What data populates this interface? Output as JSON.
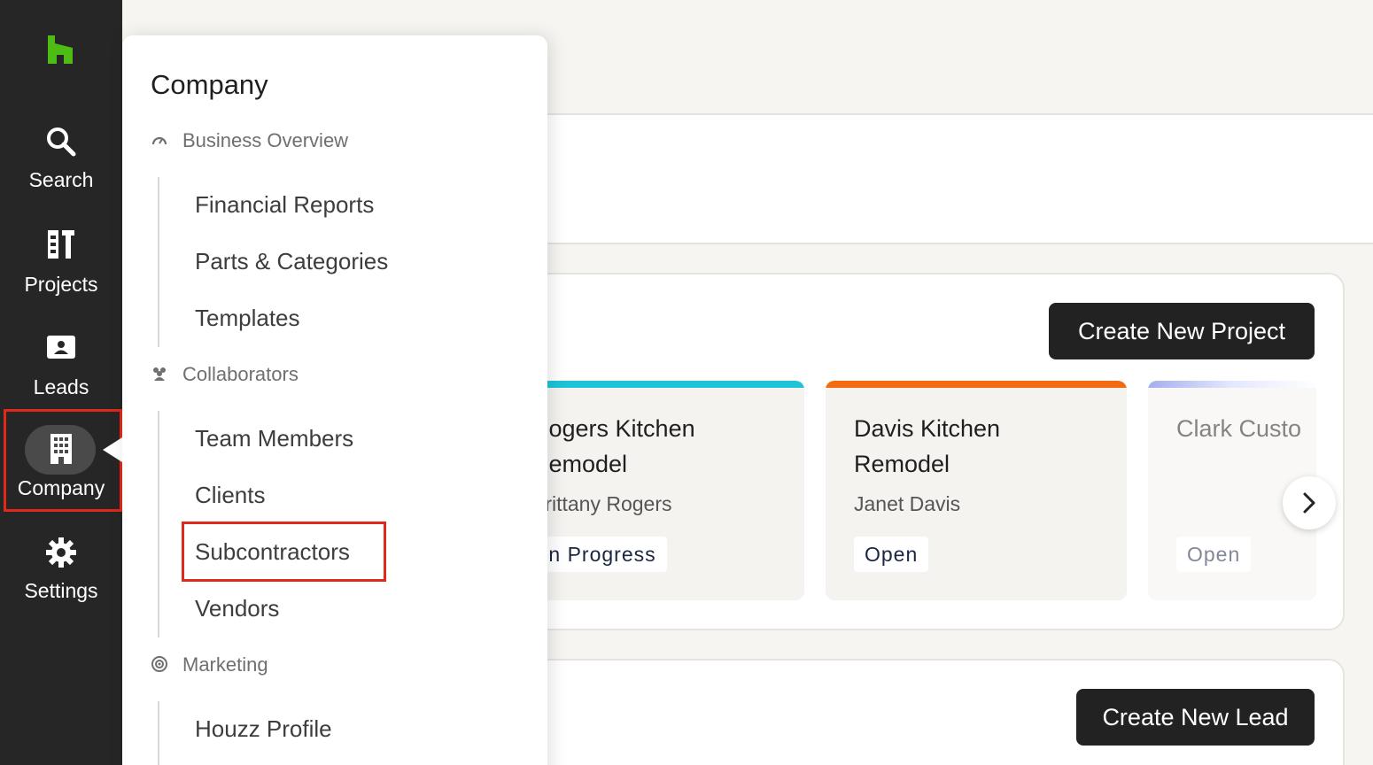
{
  "nav": {
    "search": "Search",
    "projects": "Projects",
    "leads": "Leads",
    "company": "Company",
    "settings": "Settings"
  },
  "menu": {
    "title": "Company",
    "sections": [
      {
        "label": "Business Overview",
        "icon": "gauge-icon",
        "items": [
          "Financial Reports",
          "Parts & Categories",
          "Templates"
        ]
      },
      {
        "label": "Collaborators",
        "icon": "people-icon",
        "items": [
          "Team Members",
          "Clients",
          "Subcontractors",
          "Vendors"
        ]
      },
      {
        "label": "Marketing",
        "icon": "target-icon",
        "items": [
          "Houzz Profile"
        ]
      }
    ]
  },
  "main": {
    "create_project": "Create New Project",
    "create_lead": "Create New Lead",
    "cards": [
      {
        "title": "Rogers Kitchen Remodel",
        "client": "Brittany Rogers",
        "status": "In Progress",
        "accent": "#1ec3d6"
      },
      {
        "title": "Davis Kitchen Remodel",
        "client": "Janet Davis",
        "status": "Open",
        "accent": "#f26b11"
      },
      {
        "title": "Clark Custo",
        "client": "",
        "status": "Open",
        "accent": "#5b6de0"
      }
    ]
  },
  "colors": {
    "brand": "#4dbc15",
    "rail": "#262626",
    "highlight": "#e0281b"
  }
}
